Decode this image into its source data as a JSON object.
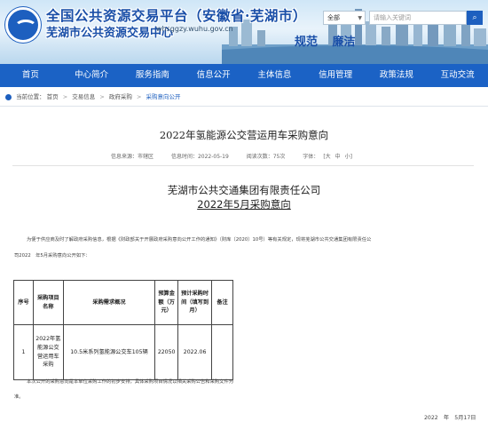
{
  "header": {
    "title_line1": "全国公共资源交易平台（安徽省·芜湖市）",
    "title_line2": "芜湖市公共资源交易中心",
    "url": "whsggzy.wuhu.gov.cn",
    "slogan": [
      "规范",
      "廉洁"
    ],
    "search_select": "全部",
    "search_placeholder": "请输入关键词"
  },
  "nav": [
    "首页",
    "中心简介",
    "服务指南",
    "信息公开",
    "主体信息",
    "信用管理",
    "政策法规",
    "互动交流"
  ],
  "breadcrumb": {
    "prefix": "当前位置：",
    "items": [
      "首页",
      "交易信息",
      "政府采购",
      "采购意向公开"
    ]
  },
  "article": {
    "title": "2022年氢能源公交营运用车采购意向",
    "meta": {
      "source": "信息来源：市辖区",
      "date": "信息时间：2022-05-19",
      "views": "阅读次数：75次",
      "font_label": "字体：",
      "font_sizes": [
        "[大",
        "中",
        "小]"
      ]
    },
    "org": "芜湖市公共交通集团有限责任公司",
    "subtitle_year": "2022",
    "subtitle_mid": "年",
    "subtitle_month": "5",
    "subtitle_end": "月采购意向",
    "para1": "为便于供应商及时了解政府采购信息，根据《财政部关于开展政府采购意向公开工作的通知》（财库〔2020〕10号）等有关规定，现将芜湖市公共交通集团有限责任公",
    "para2": "司2022　年5月采购意向公开如下：",
    "table": {
      "headers": [
        "序号",
        "采购项目名称",
        "采购需求概况",
        "预算金额（万元）",
        "预计采购时间（填写到月）",
        "备注"
      ],
      "rows": [
        [
          "1",
          "2022年氢能源公交营运用车采购",
          "10.5米系列氢能源公交车105辆",
          "22050",
          "2022.06",
          ""
        ]
      ]
    },
    "para3": "本次公开的采购意向是本单位采购工作的初步安排，具体采购项目情况以相关采购公告和采购文件为",
    "para4": "准。",
    "date": "2022　年　5月17日"
  }
}
